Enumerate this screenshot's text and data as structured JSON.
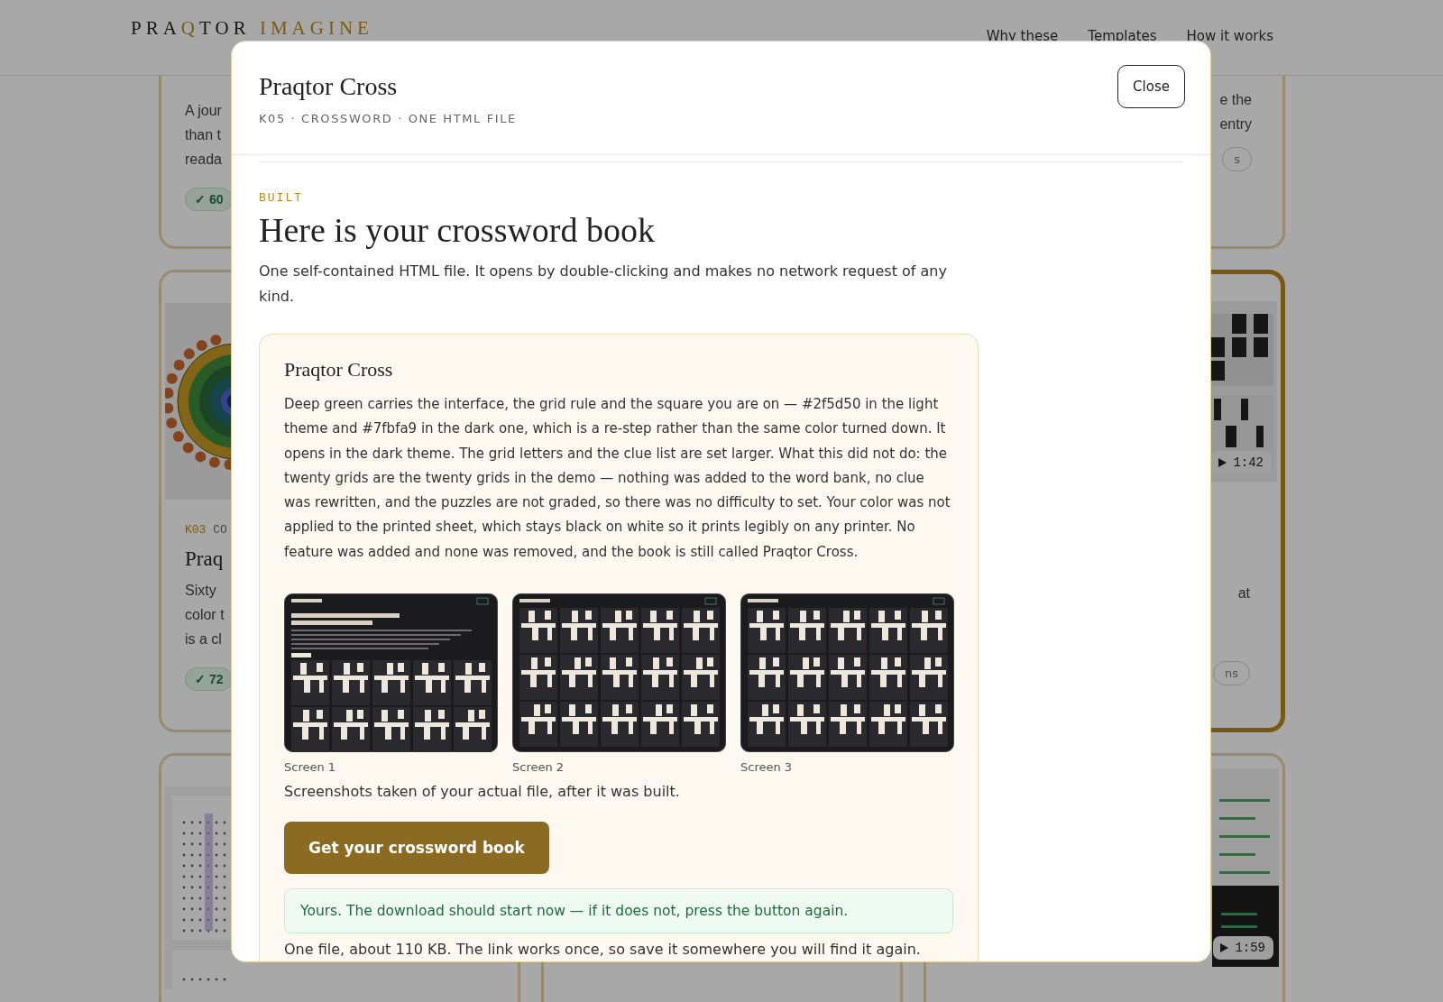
{
  "header": {
    "logo": [
      {
        "text": "PRA",
        "accent": false
      },
      {
        "text": "Q",
        "accent": true
      },
      {
        "text": "TOR",
        "accent": false
      },
      {
        "text": " IMAGINE",
        "accent": true
      }
    ],
    "nav": [
      {
        "label": "Why these"
      },
      {
        "label": "Templates"
      },
      {
        "label": "How it works"
      }
    ]
  },
  "background_rows": [
    {
      "left": {
        "lines": [
          "A jour",
          "than t",
          "reada"
        ],
        "score": "✓ 60"
      },
      "right": {
        "selected": false,
        "lines": [
          "e the",
          "entry"
        ],
        "tag": "s"
      }
    },
    {
      "left": {
        "kind": "rings",
        "code": "K03",
        "label": "CO",
        "title": "Praq",
        "lines": [
          "Sixty",
          "color t",
          "is a cl"
        ],
        "score": "✓ 72"
      },
      "right": {
        "selected": true,
        "kind": "crossword",
        "duration": "1:42",
        "lines": [
          "at"
        ],
        "tag": "ns"
      }
    },
    {
      "left": {
        "kind": "wordsearch"
      },
      "right": {
        "selected": false,
        "kind": "tracker",
        "duration": "1:59"
      }
    }
  ],
  "modal": {
    "title": "Praqtor Cross",
    "subtitle": "K05 · CROSSWORD · ONE HTML FILE",
    "close": "Close",
    "eyebrow": "BUILT",
    "heading": "Here is your crossword book",
    "intro": "One self-contained HTML file. It opens by double-clicking and makes no network request of any kind.",
    "result": {
      "title": "Praqtor Cross",
      "description": "Deep green carries the interface, the grid rule and the square you are on — #2f5d50 in the light theme and #7fbfa9 in the dark one, which is a re-step rather than the same color turned down. It opens in the dark theme. The grid letters and the clue list are set larger. What this did not do: the twenty grids are the twenty grids in the demo — nothing was added to the word bank, no clue was rewritten, and the puzzles are not graded, so there was no difficulty to set. Your color was not applied to the printed sheet, which stays black on white so it prints legibly on any printer. No feature was added and none was removed, and the book is still called Praqtor Cross.",
      "screens": [
        {
          "caption": "Screen 1",
          "kind": "landing"
        },
        {
          "caption": "Screen 2",
          "kind": "grid"
        },
        {
          "caption": "Screen 3",
          "kind": "grid"
        }
      ],
      "note": "Screenshots taken of your actual file, after it was built.",
      "button": "Get your crossword book",
      "success": "Yours. The download should start now — if it does not, press the button again.",
      "footnote": "One file, about 110 KB. The link works once, so save it somewhere you will find it again."
    }
  }
}
